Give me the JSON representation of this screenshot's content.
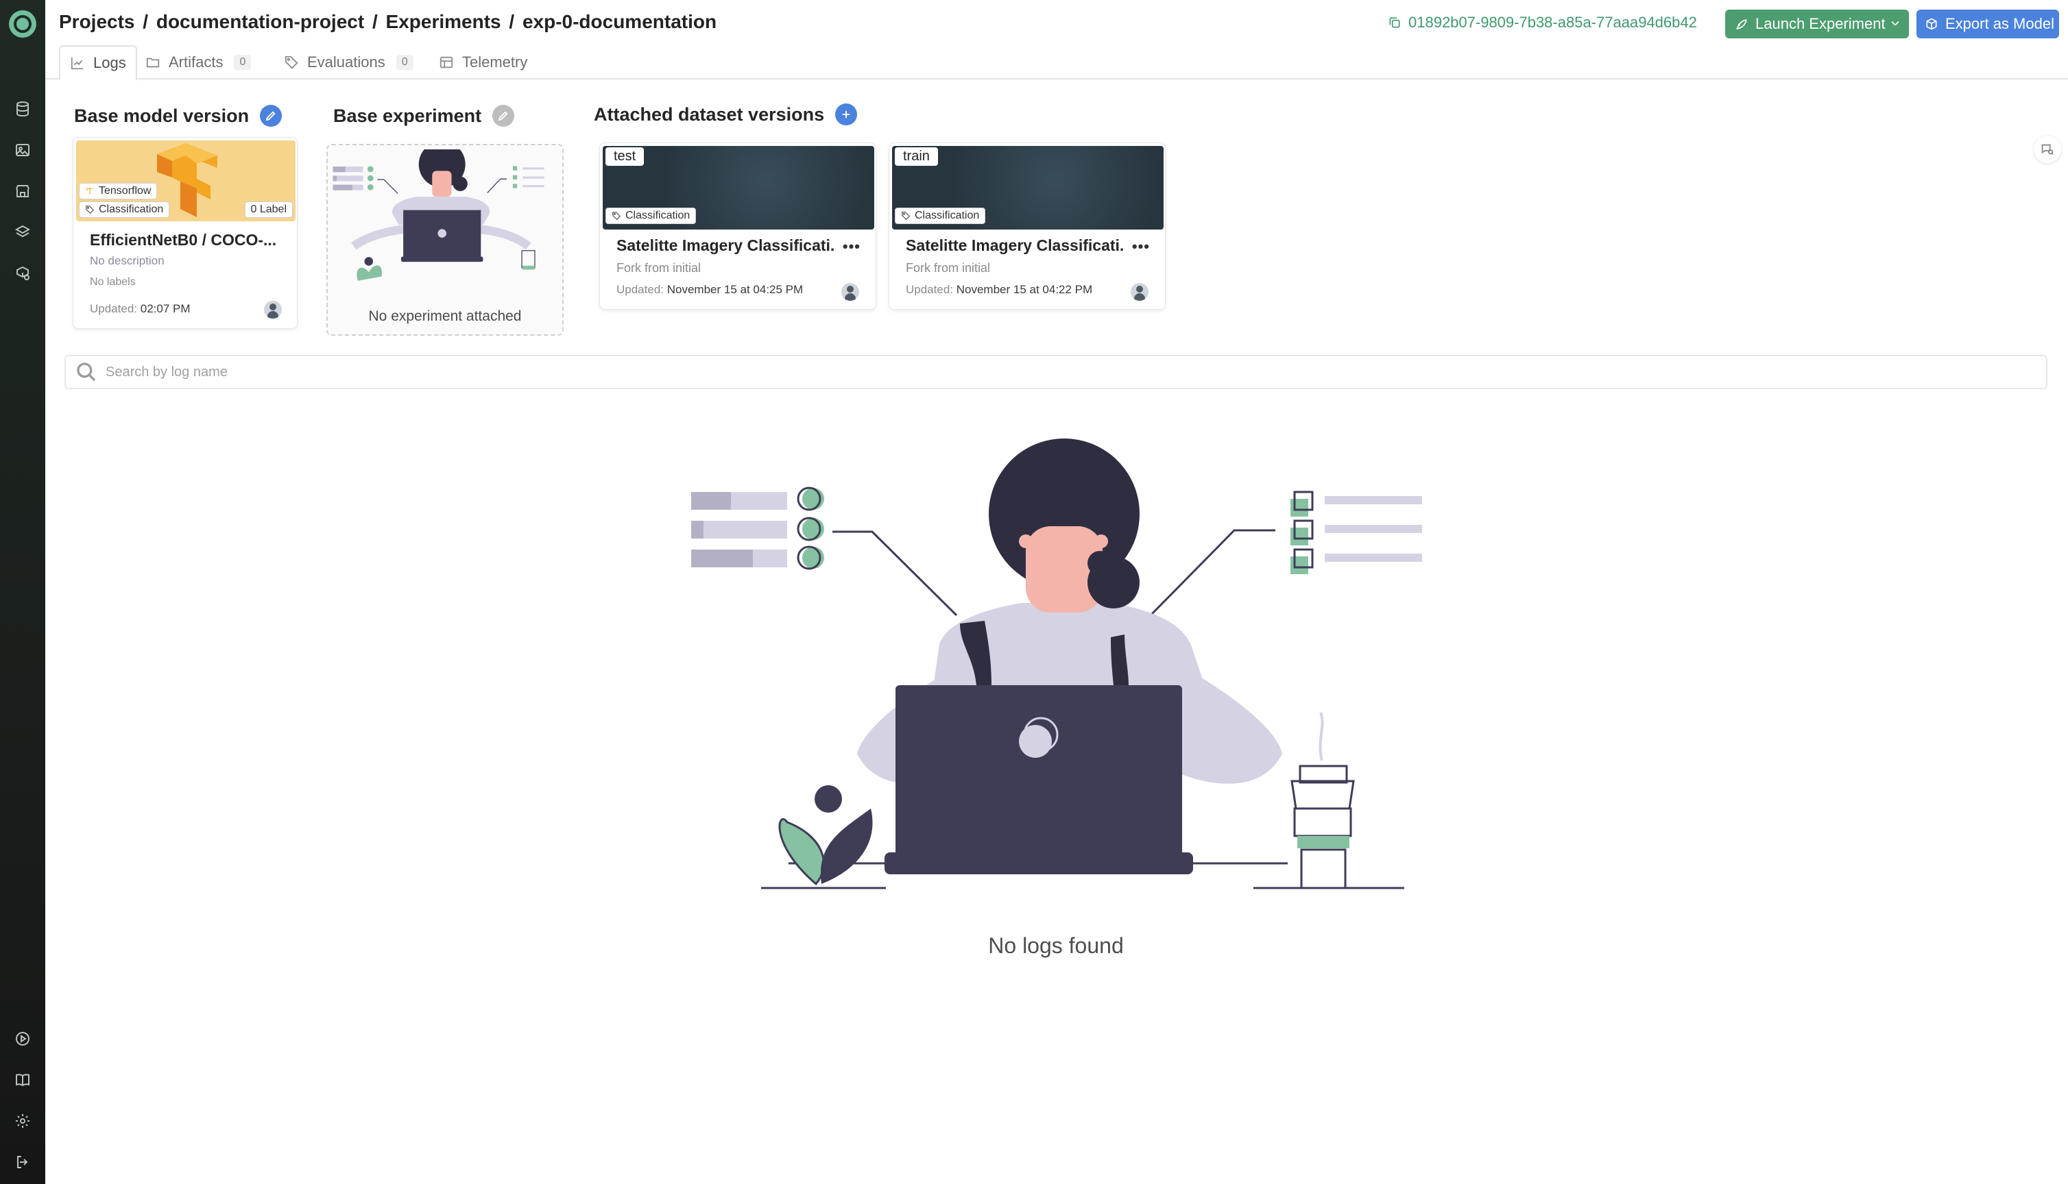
{
  "breadcrumb": {
    "projects": "Projects",
    "project": "documentation-project",
    "experiments": "Experiments",
    "experiment": "exp-0-documentation",
    "sep": "/"
  },
  "header": {
    "experiment_id": "01892b07-9809-7b38-a85a-77aaa94d6b42",
    "launch_label": "Launch Experiment",
    "export_label": "Export as Model"
  },
  "tabs": [
    {
      "label": "Logs",
      "active": true
    },
    {
      "label": "Artifacts",
      "count": "0"
    },
    {
      "label": "Evaluations",
      "count": "0"
    },
    {
      "label": "Telemetry"
    }
  ],
  "sections": {
    "base_model": "Base model version",
    "base_experiment": "Base experiment",
    "datasets": "Attached dataset versions"
  },
  "model_card": {
    "framework": "Tensorflow",
    "type": "Classification",
    "labels_badge": "0 Label",
    "name": "EfficientNetB0 / COCO-...",
    "description": "No description",
    "labels": "No labels",
    "updated_label": "Updated:",
    "updated_value": "02:07 PM"
  },
  "experiment_card": {
    "caption": "No experiment attached"
  },
  "datasets": [
    {
      "tag": "test",
      "type": "Classification",
      "title": "Satelitte Imagery Classificati...",
      "fork": "Fork from initial",
      "updated_label": "Updated:",
      "updated_value": "November 15 at 04:25 PM",
      "menu": "•••"
    },
    {
      "tag": "train",
      "type": "Classification",
      "title": "Satelitte Imagery Classificati...",
      "fork": "Fork from initial",
      "updated_label": "Updated:",
      "updated_value": "November 15 at 04:22 PM",
      "menu": "•••"
    }
  ],
  "search": {
    "placeholder": "Search by log name"
  },
  "empty_state": {
    "message": "No logs found"
  },
  "colors": {
    "accent_green": "#4c9d6f",
    "accent_blue": "#4a82dd",
    "sidebar_bg": "#1c1c1c",
    "illustration_dark": "#3f3d56",
    "illustration_green": "#86c2a2",
    "illustration_lavender": "#d5d2e3"
  }
}
